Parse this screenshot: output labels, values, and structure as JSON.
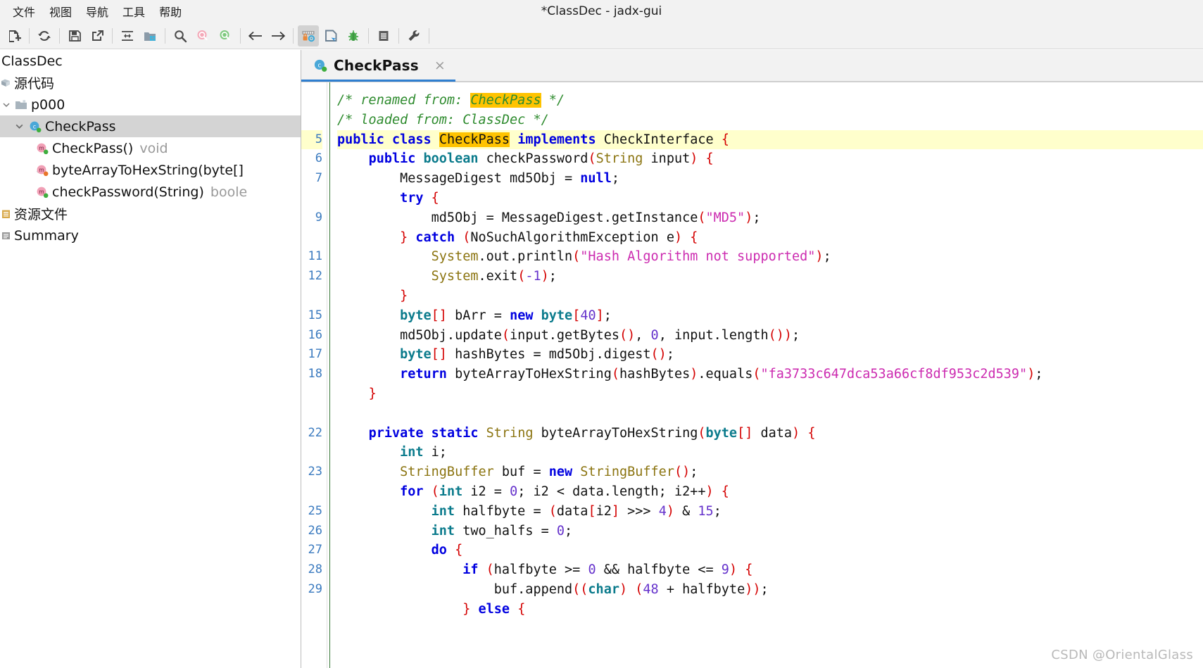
{
  "window": {
    "title": "*ClassDec - jadx-gui"
  },
  "menubar": {
    "items": [
      {
        "label": "文件",
        "name": "menu-file"
      },
      {
        "label": "视图",
        "name": "menu-view"
      },
      {
        "label": "导航",
        "name": "menu-navigation"
      },
      {
        "label": "工具",
        "name": "menu-tools"
      },
      {
        "label": "帮助",
        "name": "menu-help"
      }
    ]
  },
  "toolbar": {
    "buttons": [
      {
        "icon": "open-file-icon",
        "selected": false
      },
      {
        "icon": "reload-icon",
        "selected": false
      },
      {
        "icon": "save-all-icon",
        "selected": false
      },
      {
        "icon": "export-gradle-icon",
        "selected": false
      },
      {
        "icon": "sync-icon",
        "selected": false
      },
      {
        "icon": "flat-packages-icon",
        "selected": false
      },
      {
        "icon": "search-icon",
        "selected": false
      },
      {
        "icon": "search-class-icon",
        "selected": false
      },
      {
        "icon": "search-resource-icon",
        "selected": false
      },
      {
        "icon": "back-arrow-icon",
        "selected": false
      },
      {
        "icon": "forward-arrow-icon",
        "selected": false
      },
      {
        "icon": "deobfuscation-icon",
        "selected": true
      },
      {
        "icon": "decompile-icon",
        "selected": false
      },
      {
        "icon": "debugger-icon",
        "selected": false
      },
      {
        "icon": "log-icon",
        "selected": false
      },
      {
        "icon": "preferences-wrench-icon",
        "selected": false
      }
    ]
  },
  "sidebar": {
    "tree": [
      {
        "label": "ClassDec",
        "type": "",
        "icon": "apk-icon",
        "indent": 0,
        "twisty": "",
        "selected": false,
        "cjk": false
      },
      {
        "label": "源代码",
        "type": "",
        "icon": "sources-icon",
        "indent": 0,
        "twisty": "",
        "selected": false,
        "cjk": true
      },
      {
        "label": "p000",
        "type": "",
        "icon": "package-icon",
        "indent": 1,
        "twisty": "down",
        "selected": false,
        "cjk": false
      },
      {
        "label": "CheckPass",
        "type": "",
        "icon": "class-icon",
        "indent": 2,
        "twisty": "down",
        "selected": true,
        "cjk": false
      },
      {
        "label": "CheckPass()",
        "type": "void",
        "icon": "method-icon",
        "indent": 3,
        "twisty": "",
        "selected": false,
        "cjk": false
      },
      {
        "label": "byteArrayToHexString(byte[]",
        "type": "",
        "icon": "method-static-icon",
        "indent": 3,
        "twisty": "",
        "selected": false,
        "cjk": false
      },
      {
        "label": "checkPassword(String)",
        "type": "boole",
        "icon": "method-icon",
        "indent": 3,
        "twisty": "",
        "selected": false,
        "cjk": false
      },
      {
        "label": "资源文件",
        "type": "",
        "icon": "resources-icon",
        "indent": 0,
        "twisty": "",
        "selected": false,
        "cjk": true
      },
      {
        "label": "Summary",
        "type": "",
        "icon": "summary-icon",
        "indent": 0,
        "twisty": "",
        "selected": false,
        "cjk": false
      }
    ]
  },
  "editor": {
    "tab": {
      "label": "CheckPass",
      "icon": "class-icon",
      "close": "×"
    },
    "line_numbers": [
      "",
      "",
      "5",
      "6",
      "7",
      "",
      "9",
      "",
      "11",
      "12",
      "",
      "15",
      "16",
      "17",
      "18",
      "",
      "",
      "22",
      "",
      "23",
      "",
      "25",
      "26",
      "27",
      "28",
      "29",
      ""
    ],
    "highlight_line_index": 2,
    "code_lines": [
      [
        {
          "t": "/* renamed from: ",
          "c": "t-cmt"
        },
        {
          "t": "CheckPass",
          "c": "t-hlc"
        },
        {
          "t": " */",
          "c": "t-cmt"
        }
      ],
      [
        {
          "t": "/* loaded from: ClassDec */",
          "c": "t-cmt"
        }
      ],
      [
        {
          "t": "public",
          "c": "t-kw"
        },
        {
          "t": " ",
          "c": "t-plain"
        },
        {
          "t": "class",
          "c": "t-kw"
        },
        {
          "t": " ",
          "c": "t-plain"
        },
        {
          "t": "CheckPass",
          "c": "t-hl"
        },
        {
          "t": " ",
          "c": "t-plain"
        },
        {
          "t": "implements",
          "c": "t-kw"
        },
        {
          "t": " CheckInterface ",
          "c": "t-plain"
        },
        {
          "t": "{",
          "c": "t-paren"
        }
      ],
      [
        {
          "t": "    ",
          "c": "t-plain"
        },
        {
          "t": "public",
          "c": "t-kw"
        },
        {
          "t": " ",
          "c": "t-plain"
        },
        {
          "t": "boolean",
          "c": "t-typ"
        },
        {
          "t": " checkPassword",
          "c": "t-plain"
        },
        {
          "t": "(",
          "c": "t-paren"
        },
        {
          "t": "String",
          "c": "t-cls"
        },
        {
          "t": " input",
          "c": "t-plain"
        },
        {
          "t": ")",
          "c": "t-paren"
        },
        {
          "t": " ",
          "c": "t-plain"
        },
        {
          "t": "{",
          "c": "t-paren"
        }
      ],
      [
        {
          "t": "        MessageDigest md5Obj = ",
          "c": "t-plain"
        },
        {
          "t": "null",
          "c": "t-kw"
        },
        {
          "t": ";",
          "c": "t-plain"
        }
      ],
      [
        {
          "t": "        ",
          "c": "t-plain"
        },
        {
          "t": "try",
          "c": "t-kw"
        },
        {
          "t": " ",
          "c": "t-plain"
        },
        {
          "t": "{",
          "c": "t-paren"
        }
      ],
      [
        {
          "t": "            md5Obj = MessageDigest.getInstance",
          "c": "t-plain"
        },
        {
          "t": "(",
          "c": "t-paren"
        },
        {
          "t": "\"MD5\"",
          "c": "t-str"
        },
        {
          "t": ")",
          "c": "t-paren"
        },
        {
          "t": ";",
          "c": "t-plain"
        }
      ],
      [
        {
          "t": "        ",
          "c": "t-plain"
        },
        {
          "t": "}",
          "c": "t-paren"
        },
        {
          "t": " ",
          "c": "t-plain"
        },
        {
          "t": "catch",
          "c": "t-kw"
        },
        {
          "t": " ",
          "c": "t-plain"
        },
        {
          "t": "(",
          "c": "t-paren"
        },
        {
          "t": "NoSuchAlgorithmException e",
          "c": "t-plain"
        },
        {
          "t": ")",
          "c": "t-paren"
        },
        {
          "t": " ",
          "c": "t-plain"
        },
        {
          "t": "{",
          "c": "t-paren"
        }
      ],
      [
        {
          "t": "            ",
          "c": "t-plain"
        },
        {
          "t": "System",
          "c": "t-fld"
        },
        {
          "t": ".out.println",
          "c": "t-plain"
        },
        {
          "t": "(",
          "c": "t-paren"
        },
        {
          "t": "\"Hash Algorithm not supported\"",
          "c": "t-str"
        },
        {
          "t": ")",
          "c": "t-paren"
        },
        {
          "t": ";",
          "c": "t-plain"
        }
      ],
      [
        {
          "t": "            ",
          "c": "t-plain"
        },
        {
          "t": "System",
          "c": "t-fld"
        },
        {
          "t": ".exit",
          "c": "t-plain"
        },
        {
          "t": "(",
          "c": "t-paren"
        },
        {
          "t": "-1",
          "c": "t-num"
        },
        {
          "t": ")",
          "c": "t-paren"
        },
        {
          "t": ";",
          "c": "t-plain"
        }
      ],
      [
        {
          "t": "        ",
          "c": "t-plain"
        },
        {
          "t": "}",
          "c": "t-paren"
        }
      ],
      [
        {
          "t": "        ",
          "c": "t-plain"
        },
        {
          "t": "byte",
          "c": "t-typ"
        },
        {
          "t": "[]",
          "c": "t-paren"
        },
        {
          "t": " bArr = ",
          "c": "t-plain"
        },
        {
          "t": "new",
          "c": "t-kw"
        },
        {
          "t": " ",
          "c": "t-plain"
        },
        {
          "t": "byte",
          "c": "t-typ"
        },
        {
          "t": "[",
          "c": "t-paren"
        },
        {
          "t": "40",
          "c": "t-num"
        },
        {
          "t": "]",
          "c": "t-paren"
        },
        {
          "t": ";",
          "c": "t-plain"
        }
      ],
      [
        {
          "t": "        md5Obj.update",
          "c": "t-plain"
        },
        {
          "t": "(",
          "c": "t-paren"
        },
        {
          "t": "input.getBytes",
          "c": "t-plain"
        },
        {
          "t": "()",
          "c": "t-paren"
        },
        {
          "t": ", ",
          "c": "t-plain"
        },
        {
          "t": "0",
          "c": "t-num"
        },
        {
          "t": ", input.length",
          "c": "t-plain"
        },
        {
          "t": "()",
          "c": "t-paren"
        },
        {
          "t": ")",
          "c": "t-paren"
        },
        {
          "t": ";",
          "c": "t-plain"
        }
      ],
      [
        {
          "t": "        ",
          "c": "t-plain"
        },
        {
          "t": "byte",
          "c": "t-typ"
        },
        {
          "t": "[]",
          "c": "t-paren"
        },
        {
          "t": " hashBytes = md5Obj.digest",
          "c": "t-plain"
        },
        {
          "t": "()",
          "c": "t-paren"
        },
        {
          "t": ";",
          "c": "t-plain"
        }
      ],
      [
        {
          "t": "        ",
          "c": "t-plain"
        },
        {
          "t": "return",
          "c": "t-kw"
        },
        {
          "t": " byteArrayToHexString",
          "c": "t-plain"
        },
        {
          "t": "(",
          "c": "t-paren"
        },
        {
          "t": "hashBytes",
          "c": "t-plain"
        },
        {
          "t": ")",
          "c": "t-paren"
        },
        {
          "t": ".equals",
          "c": "t-plain"
        },
        {
          "t": "(",
          "c": "t-paren"
        },
        {
          "t": "\"fa3733c647dca53a66cf8df953c2d539\"",
          "c": "t-str"
        },
        {
          "t": ")",
          "c": "t-paren"
        },
        {
          "t": ";",
          "c": "t-plain"
        }
      ],
      [
        {
          "t": "    ",
          "c": "t-plain"
        },
        {
          "t": "}",
          "c": "t-paren"
        }
      ],
      [
        {
          "t": "",
          "c": "t-plain"
        }
      ],
      [
        {
          "t": "    ",
          "c": "t-plain"
        },
        {
          "t": "private",
          "c": "t-kw"
        },
        {
          "t": " ",
          "c": "t-plain"
        },
        {
          "t": "static",
          "c": "t-kw"
        },
        {
          "t": " ",
          "c": "t-plain"
        },
        {
          "t": "String",
          "c": "t-cls"
        },
        {
          "t": " byteArrayToHexString",
          "c": "t-plain"
        },
        {
          "t": "(",
          "c": "t-paren"
        },
        {
          "t": "byte",
          "c": "t-typ"
        },
        {
          "t": "[]",
          "c": "t-paren"
        },
        {
          "t": " data",
          "c": "t-plain"
        },
        {
          "t": ")",
          "c": "t-paren"
        },
        {
          "t": " ",
          "c": "t-plain"
        },
        {
          "t": "{",
          "c": "t-paren"
        }
      ],
      [
        {
          "t": "        ",
          "c": "t-plain"
        },
        {
          "t": "int",
          "c": "t-typ"
        },
        {
          "t": " i;",
          "c": "t-plain"
        }
      ],
      [
        {
          "t": "        ",
          "c": "t-plain"
        },
        {
          "t": "StringBuffer",
          "c": "t-cls"
        },
        {
          "t": " buf = ",
          "c": "t-plain"
        },
        {
          "t": "new",
          "c": "t-kw"
        },
        {
          "t": " ",
          "c": "t-plain"
        },
        {
          "t": "StringBuffer",
          "c": "t-cls"
        },
        {
          "t": "()",
          "c": "t-paren"
        },
        {
          "t": ";",
          "c": "t-plain"
        }
      ],
      [
        {
          "t": "        ",
          "c": "t-plain"
        },
        {
          "t": "for",
          "c": "t-kw"
        },
        {
          "t": " ",
          "c": "t-plain"
        },
        {
          "t": "(",
          "c": "t-paren"
        },
        {
          "t": "int",
          "c": "t-typ"
        },
        {
          "t": " i2 = ",
          "c": "t-plain"
        },
        {
          "t": "0",
          "c": "t-num"
        },
        {
          "t": "; i2 < data.length; i2++",
          "c": "t-plain"
        },
        {
          "t": ")",
          "c": "t-paren"
        },
        {
          "t": " ",
          "c": "t-plain"
        },
        {
          "t": "{",
          "c": "t-paren"
        }
      ],
      [
        {
          "t": "            ",
          "c": "t-plain"
        },
        {
          "t": "int",
          "c": "t-typ"
        },
        {
          "t": " halfbyte = ",
          "c": "t-plain"
        },
        {
          "t": "(",
          "c": "t-paren"
        },
        {
          "t": "data",
          "c": "t-plain"
        },
        {
          "t": "[",
          "c": "t-paren"
        },
        {
          "t": "i2",
          "c": "t-plain"
        },
        {
          "t": "]",
          "c": "t-paren"
        },
        {
          "t": " >>> ",
          "c": "t-plain"
        },
        {
          "t": "4",
          "c": "t-num"
        },
        {
          "t": ")",
          "c": "t-paren"
        },
        {
          "t": " & ",
          "c": "t-plain"
        },
        {
          "t": "15",
          "c": "t-num"
        },
        {
          "t": ";",
          "c": "t-plain"
        }
      ],
      [
        {
          "t": "            ",
          "c": "t-plain"
        },
        {
          "t": "int",
          "c": "t-typ"
        },
        {
          "t": " two_halfs = ",
          "c": "t-plain"
        },
        {
          "t": "0",
          "c": "t-num"
        },
        {
          "t": ";",
          "c": "t-plain"
        }
      ],
      [
        {
          "t": "            ",
          "c": "t-plain"
        },
        {
          "t": "do",
          "c": "t-kw"
        },
        {
          "t": " ",
          "c": "t-plain"
        },
        {
          "t": "{",
          "c": "t-paren"
        }
      ],
      [
        {
          "t": "                ",
          "c": "t-plain"
        },
        {
          "t": "if",
          "c": "t-kw"
        },
        {
          "t": " ",
          "c": "t-plain"
        },
        {
          "t": "(",
          "c": "t-paren"
        },
        {
          "t": "halfbyte >= ",
          "c": "t-plain"
        },
        {
          "t": "0",
          "c": "t-num"
        },
        {
          "t": " && halfbyte <= ",
          "c": "t-plain"
        },
        {
          "t": "9",
          "c": "t-num"
        },
        {
          "t": ")",
          "c": "t-paren"
        },
        {
          "t": " ",
          "c": "t-plain"
        },
        {
          "t": "{",
          "c": "t-paren"
        }
      ],
      [
        {
          "t": "                    buf.append",
          "c": "t-plain"
        },
        {
          "t": "((",
          "c": "t-paren"
        },
        {
          "t": "char",
          "c": "t-typ"
        },
        {
          "t": ")",
          "c": "t-paren"
        },
        {
          "t": " ",
          "c": "t-plain"
        },
        {
          "t": "(",
          "c": "t-paren"
        },
        {
          "t": "48",
          "c": "t-num"
        },
        {
          "t": " + halfbyte",
          "c": "t-plain"
        },
        {
          "t": "))",
          "c": "t-paren"
        },
        {
          "t": ";",
          "c": "t-plain"
        }
      ],
      [
        {
          "t": "                ",
          "c": "t-plain"
        },
        {
          "t": "}",
          "c": "t-paren"
        },
        {
          "t": " ",
          "c": "t-plain"
        },
        {
          "t": "else",
          "c": "t-kw"
        },
        {
          "t": " ",
          "c": "t-plain"
        },
        {
          "t": "{",
          "c": "t-paren"
        }
      ]
    ]
  },
  "watermark": {
    "text": "CSDN @OrientalGlass"
  },
  "colors": {
    "accent": "#2f7fd0",
    "highlight_line": "#ffffcc",
    "highlight_token": "#ffc300",
    "selection": "#d4d4d4",
    "toolbar_bg": "#f2f2f2"
  }
}
